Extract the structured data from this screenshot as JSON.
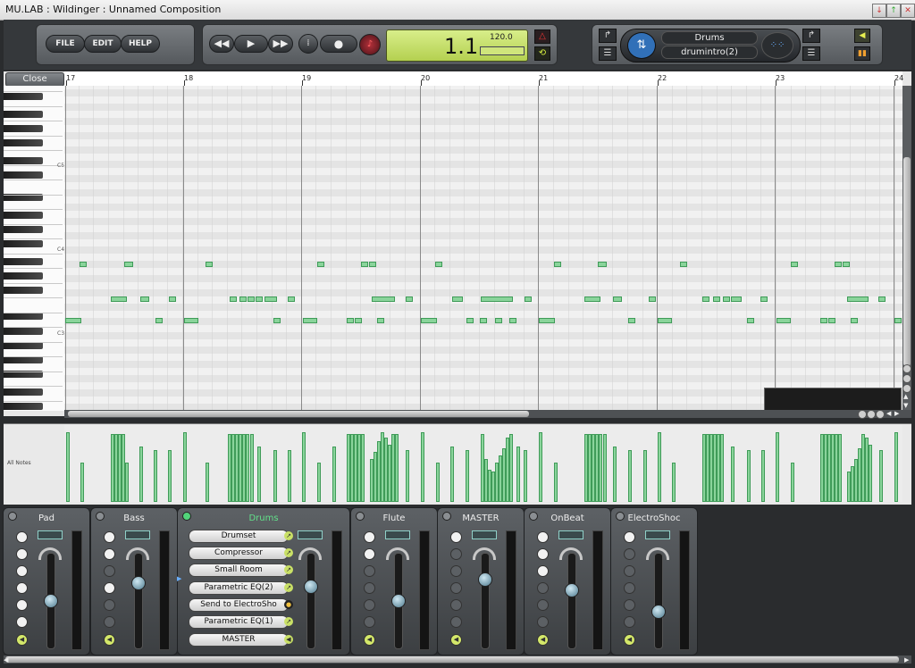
{
  "window": {
    "title": "MU.LAB : Wildinger : Unnamed Composition"
  },
  "menu": {
    "file": "FILE",
    "edit": "EDIT",
    "help": "HELP"
  },
  "transport": {
    "position": "1.1",
    "tempo": "120.0"
  },
  "track_selector": {
    "track": "Drums",
    "part": "drumintro(2)"
  },
  "editor": {
    "close_label": "Close",
    "key_labels": [
      "C5",
      "C4",
      "C3"
    ],
    "bar_numbers": [
      "17",
      "18",
      "19",
      "20",
      "21",
      "22",
      "23",
      "24"
    ]
  },
  "velocity": {
    "label": "All Notes"
  },
  "mixer": {
    "strips": [
      {
        "name": "Pad",
        "dots": [
          1,
          1,
          1,
          1,
          1,
          1
        ]
      },
      {
        "name": "Bass",
        "dots": [
          1,
          1,
          0,
          1,
          0,
          0
        ]
      },
      {
        "name": "Flute",
        "dots": [
          1,
          1,
          0,
          0,
          0,
          0
        ]
      },
      {
        "name": "MASTER",
        "dots": [
          1,
          0,
          0,
          0,
          0,
          0
        ]
      },
      {
        "name": "OnBeat",
        "dots": [
          1,
          1,
          1,
          0,
          0,
          0
        ]
      },
      {
        "name": "ElectroShoc",
        "dots": [
          1,
          0,
          0,
          0,
          0,
          0
        ]
      }
    ],
    "drums": {
      "name": "Drums",
      "fx": [
        "Drumset",
        "Compressor",
        "Small Room",
        "Parametric EQ(2)",
        "Send to ElectroSho",
        "Parametric EQ(1)",
        "MASTER"
      ]
    }
  },
  "colors": {
    "note": "#8ad49b",
    "lcd": "#c8e070",
    "accent_green": "#55d080"
  }
}
